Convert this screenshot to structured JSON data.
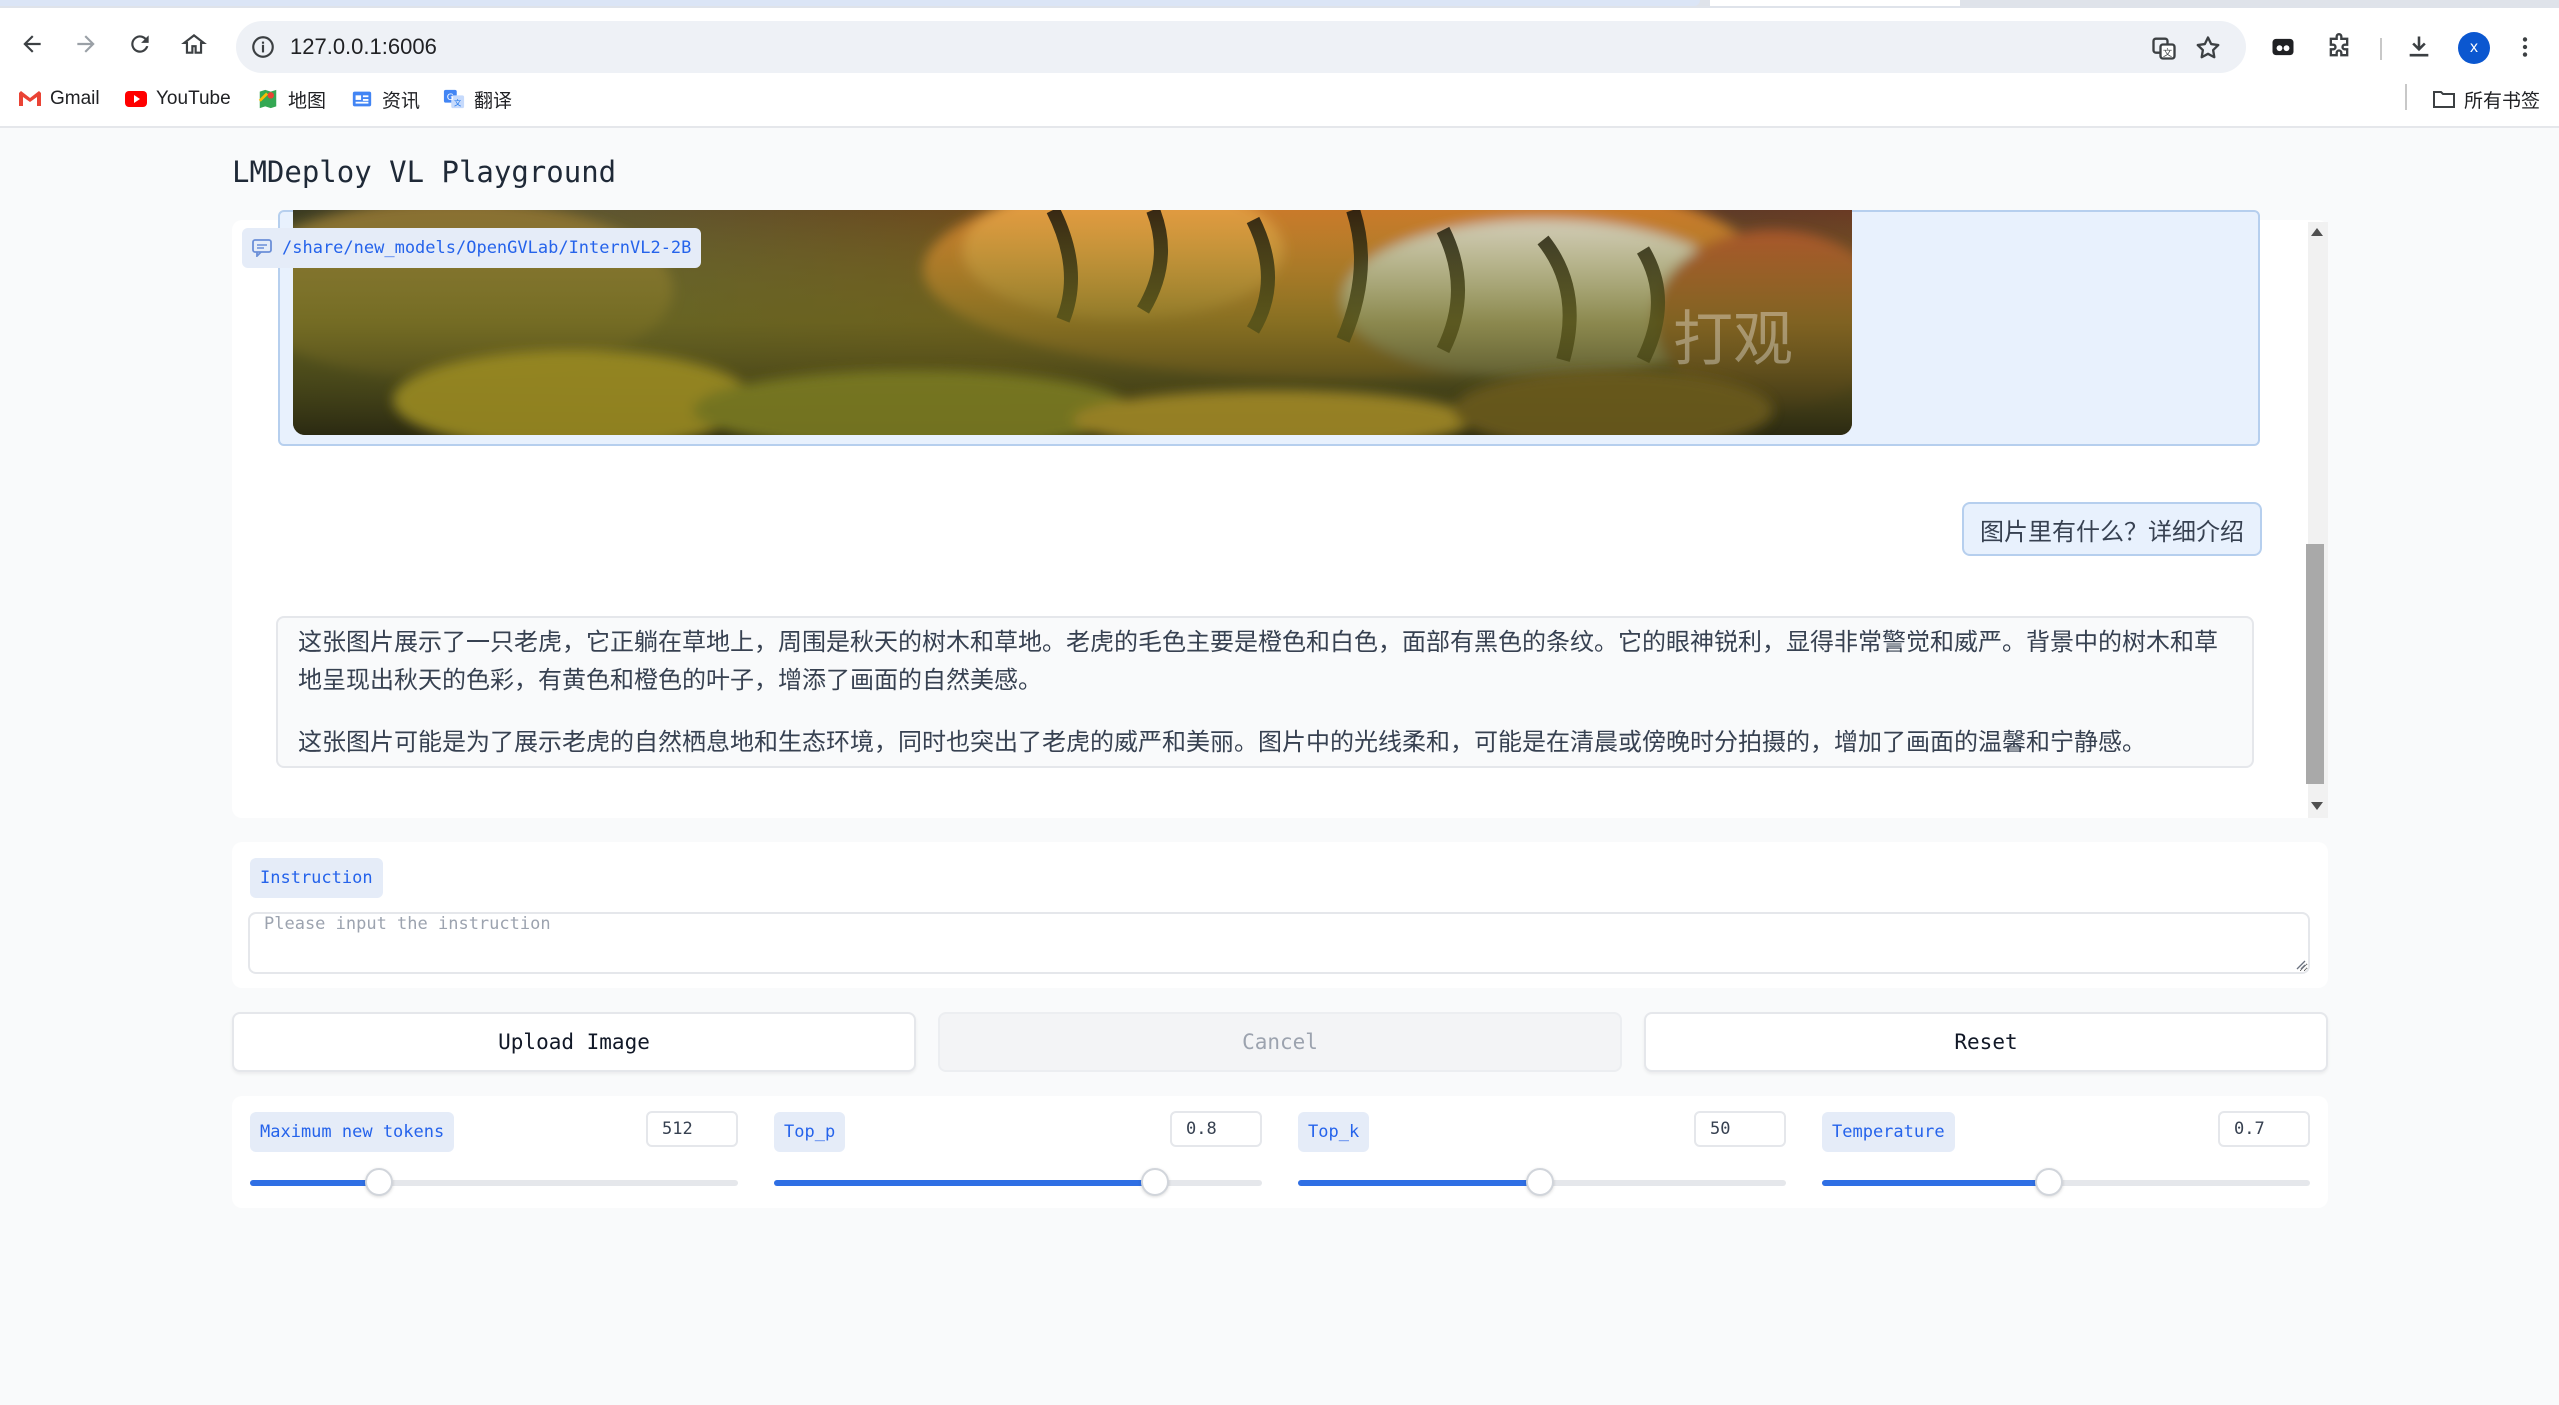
{
  "browser": {
    "url": "127.0.0.1:6006",
    "profile_initial": "x",
    "bookmarks": [
      {
        "label": "Gmail",
        "icon": "gmail-icon"
      },
      {
        "label": "YouTube",
        "icon": "youtube-icon"
      },
      {
        "label": "地图",
        "icon": "maps-icon"
      },
      {
        "label": "资讯",
        "icon": "news-icon"
      },
      {
        "label": "翻译",
        "icon": "translate-icon"
      }
    ],
    "all_bookmarks_label": "所有书签"
  },
  "app": {
    "title": "LMDeploy VL Playground",
    "chat": {
      "model_tag": "/share/new_models/OpenGVLab/InternVL2-2B",
      "user_message": "图片里有什么？详细介绍",
      "bot_paragraph_1": "这张图片展示了一只老虎，它正躺在草地上，周围是秋天的树木和草地。老虎的毛色主要是橙色和白色，面部有黑色的条纹。它的眼神锐利，显得非常警觉和威严。背景中的树木和草地呈现出秋天的色彩，有黄色和橙色的叶子，增添了画面的自然美感。",
      "bot_paragraph_2": "这张图片可能是为了展示老虎的自然栖息地和生态环境，同时也突出了老虎的威严和美丽。图片中的光线柔和，可能是在清晨或傍晚时分拍摄的，增加了画面的温馨和宁静感。",
      "watermark": "打观"
    },
    "instruction": {
      "label": "Instruction",
      "placeholder": "Please input the instruction",
      "value": ""
    },
    "buttons": {
      "upload": "Upload Image",
      "cancel": "Cancel",
      "reset": "Reset"
    },
    "sliders": [
      {
        "label": "Maximum new tokens",
        "value": "512",
        "fraction": 0.265
      },
      {
        "label": "Top_p",
        "value": "0.8",
        "fraction": 0.78
      },
      {
        "label": "Top_k",
        "value": "50",
        "fraction": 0.495
      },
      {
        "label": "Temperature",
        "value": "0.7",
        "fraction": 0.465
      }
    ]
  },
  "colors": {
    "accent": "#2f6fe4",
    "chip_bg": "#e5ecf8",
    "user_bubble": "#e8f1fd"
  }
}
